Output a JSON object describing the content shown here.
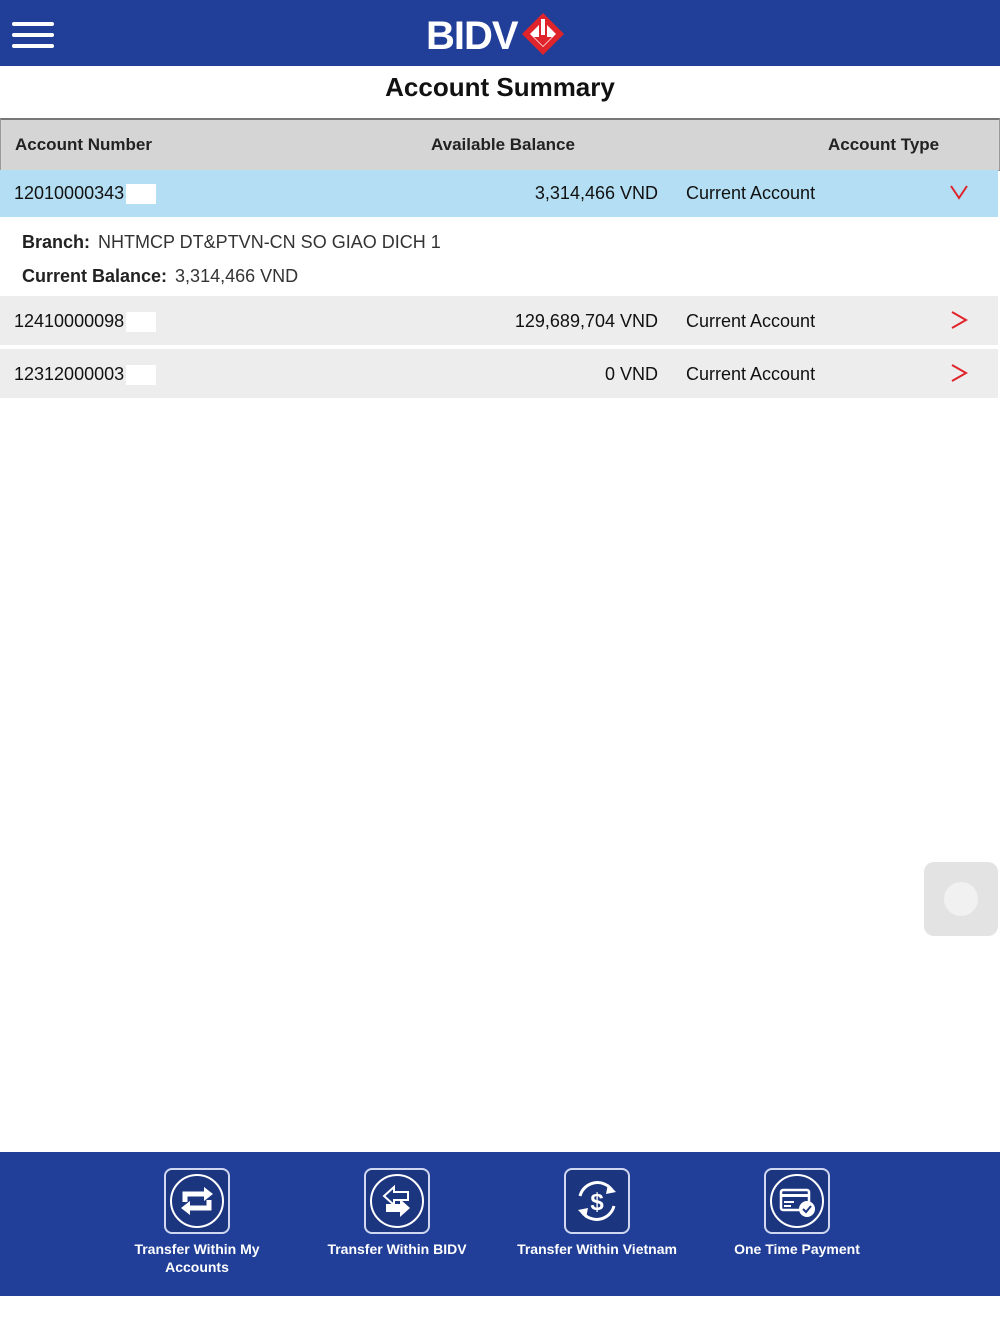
{
  "header": {
    "logo_text": "BIDV",
    "menu_icon": "hamburger-menu-icon",
    "brand_color": "#213f99",
    "accent_color": "#e0242b"
  },
  "page_title": "Account Summary",
  "table": {
    "columns": [
      "Account Number",
      "Available Balance",
      "Account Type"
    ],
    "rows": [
      {
        "account_number": "12010000343",
        "balance": "3,314,466 VND",
        "type": "Current Account",
        "expanded": true
      },
      {
        "account_number": "12410000098",
        "balance": "129,689,704 VND",
        "type": "Current Account",
        "expanded": false
      },
      {
        "account_number": "12312000003",
        "balance": "0 VND",
        "type": "Current Account",
        "expanded": false
      }
    ],
    "selected_row_color": "#b3def3",
    "detail": {
      "branch_label": "Branch:",
      "branch_value": "NHTMCP DT&PTVN-CN SO GIAO DICH 1",
      "current_balance_label": "Current Balance:",
      "current_balance_value": "3,314,466 VND"
    }
  },
  "bottom_actions": [
    {
      "label": "Transfer Within My Accounts",
      "icon": "transfer-own-accounts-icon"
    },
    {
      "label": "Transfer Within BIDV",
      "icon": "transfer-within-bidv-icon"
    },
    {
      "label": "Transfer Within Vietnam",
      "icon": "transfer-vietnam-dollar-icon"
    },
    {
      "label": "One Time Payment",
      "icon": "one-time-payment-card-icon"
    }
  ]
}
